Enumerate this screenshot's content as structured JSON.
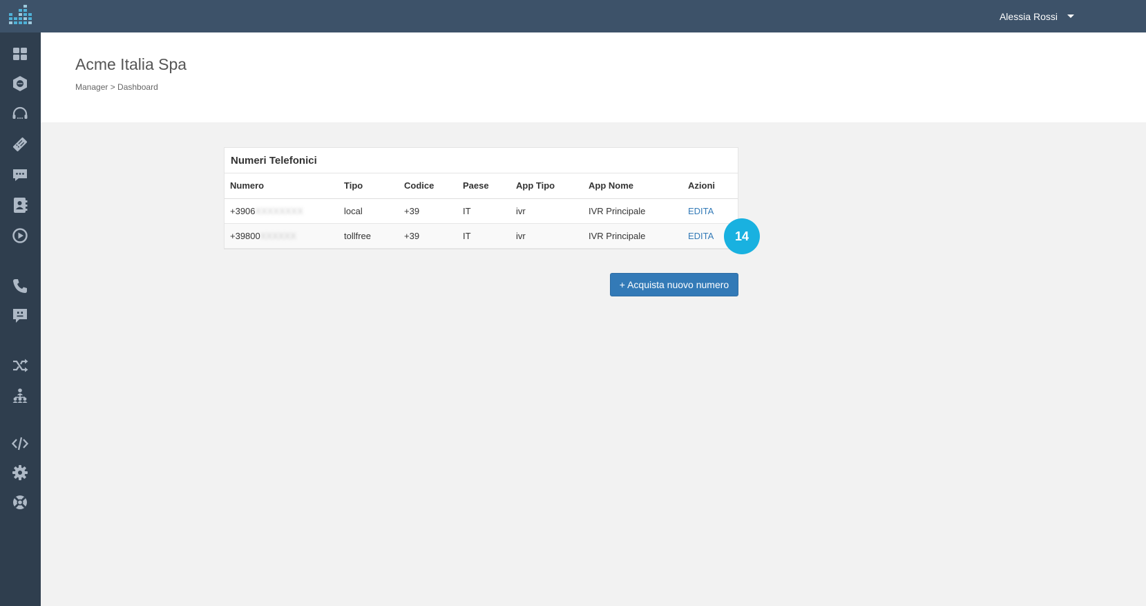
{
  "topbar": {
    "user_name": "Alessia Rossi"
  },
  "sidebar": {
    "icons": [
      "dashboard-icon",
      "chat-widget-icon",
      "headset-icon",
      "ticket-icon",
      "message-icon",
      "contacts-icon",
      "play-icon",
      "phone-icon",
      "sms-icon",
      "shuffle-icon",
      "team-icon",
      "code-icon",
      "gear-icon",
      "support-icon"
    ]
  },
  "header": {
    "title": "Acme Italia Spa",
    "breadcrumb": "Manager > Dashboard"
  },
  "panel": {
    "title": "Numeri Telefonici",
    "columns": [
      "Numero",
      "Tipo",
      "Codice",
      "Paese",
      "App Tipo",
      "App Nome",
      "Azioni"
    ],
    "rows": [
      {
        "numero_prefix": "+3906",
        "numero_hidden": "XXXXXXXX",
        "tipo": "local",
        "codice": "+39",
        "paese": "IT",
        "app_tipo": "ivr",
        "app_nome": "IVR Principale",
        "azione": "EDITA"
      },
      {
        "numero_prefix": "+39800",
        "numero_hidden": "XXXXXX",
        "tipo": "tollfree",
        "codice": "+39",
        "paese": "IT",
        "app_tipo": "ivr",
        "app_nome": "IVR Principale",
        "azione": "EDITA"
      }
    ]
  },
  "badge": {
    "value": "14",
    "color": "#19b1e0"
  },
  "buy_button": {
    "label": "+ Acquista nuovo numero"
  },
  "colors": {
    "topbar": "#3d5269",
    "sidebar": "#2f3e4e",
    "primary": "#337ab7",
    "link": "#337ab7"
  }
}
